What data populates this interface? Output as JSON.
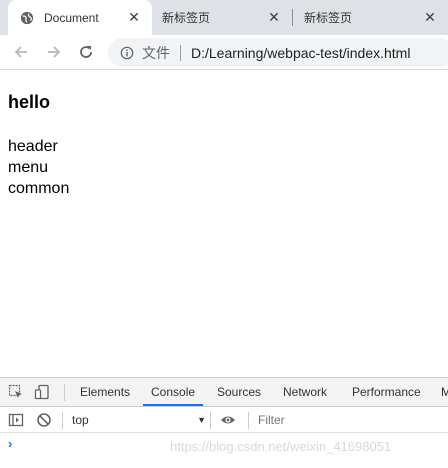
{
  "browser": {
    "tabs": [
      {
        "title": "Document",
        "active": true
      },
      {
        "title": "新标签页",
        "active": false
      },
      {
        "title": "新标签页",
        "active": false
      }
    ],
    "close_glyph": "✕"
  },
  "omnibox": {
    "security_label": "文件",
    "url": "D:/Learning/webpac-test/index.html"
  },
  "page": {
    "heading": "hello",
    "lines": [
      "header",
      "menu",
      "common"
    ]
  },
  "devtools": {
    "tabs": [
      "Elements",
      "Console",
      "Sources",
      "Network",
      "Performance",
      "M"
    ],
    "active_tab": "Console",
    "context": "top",
    "filter_placeholder": "Filter",
    "prompt": "›",
    "accent_color": "#1a73e8"
  },
  "watermark": "https://blog.csdn.net/weixin_41698051"
}
